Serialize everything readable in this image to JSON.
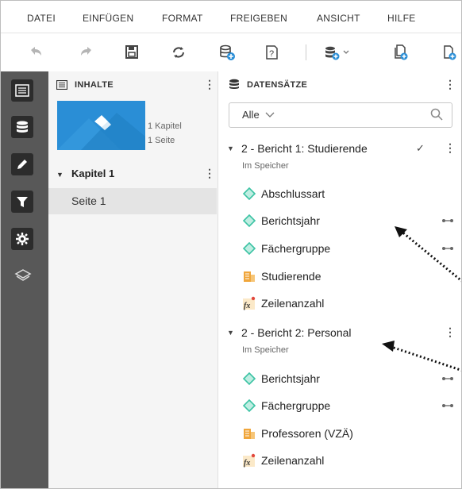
{
  "menu": [
    "DATEI",
    "EINFÜGEN",
    "FORMAT",
    "FREIGEBEN",
    "ANSICHT",
    "HILFE"
  ],
  "toolbar": {
    "icons": [
      "undo-icon",
      "redo-icon",
      "save-icon",
      "refresh-icon",
      "add-database-icon",
      "help-icon",
      "add-dataset-dropdown-icon",
      "add-page-icon",
      "add-page-icon-2"
    ]
  },
  "rail": {
    "icons": [
      "contents-icon",
      "datasets-icon",
      "edit-icon",
      "filter-icon",
      "settings-icon",
      "layers-icon"
    ]
  },
  "contents": {
    "header": "INHALTE",
    "thumb_info": {
      "chapters": "1 Kapitel",
      "pages": "1 Seite"
    },
    "chapter": "Kapitel 1",
    "page": "Seite 1"
  },
  "datasets": {
    "header": "DATENSÄTZE",
    "filter": {
      "value": "Alle"
    },
    "groups": [
      {
        "title": "2 - Bericht 1: Studierende",
        "status": "Im Speicher",
        "items": [
          {
            "label": "Abschlussart",
            "type": "dimension",
            "linked": false
          },
          {
            "label": "Berichtsjahr",
            "type": "dimension",
            "linked": true
          },
          {
            "label": "Fächergruppe",
            "type": "dimension",
            "linked": true
          },
          {
            "label": "Studierende",
            "type": "measure",
            "linked": false
          },
          {
            "label": "Zeilenanzahl",
            "type": "formula",
            "linked": false
          }
        ]
      },
      {
        "title": "2 - Bericht 2: Personal",
        "status": "Im Speicher",
        "items": [
          {
            "label": "Berichtsjahr",
            "type": "dimension",
            "linked": true
          },
          {
            "label": "Fächergruppe",
            "type": "dimension",
            "linked": true
          },
          {
            "label": "Professoren (VZÄ)",
            "type": "measure",
            "linked": false
          },
          {
            "label": "Zeilenanzahl",
            "type": "formula",
            "linked": false
          }
        ]
      }
    ]
  },
  "colors": {
    "rail": "#585858",
    "dimension": "#3cc3a4",
    "measure": "#f0a63b",
    "thumb": "#2a8ed6",
    "selected": "#e4e4e4"
  }
}
